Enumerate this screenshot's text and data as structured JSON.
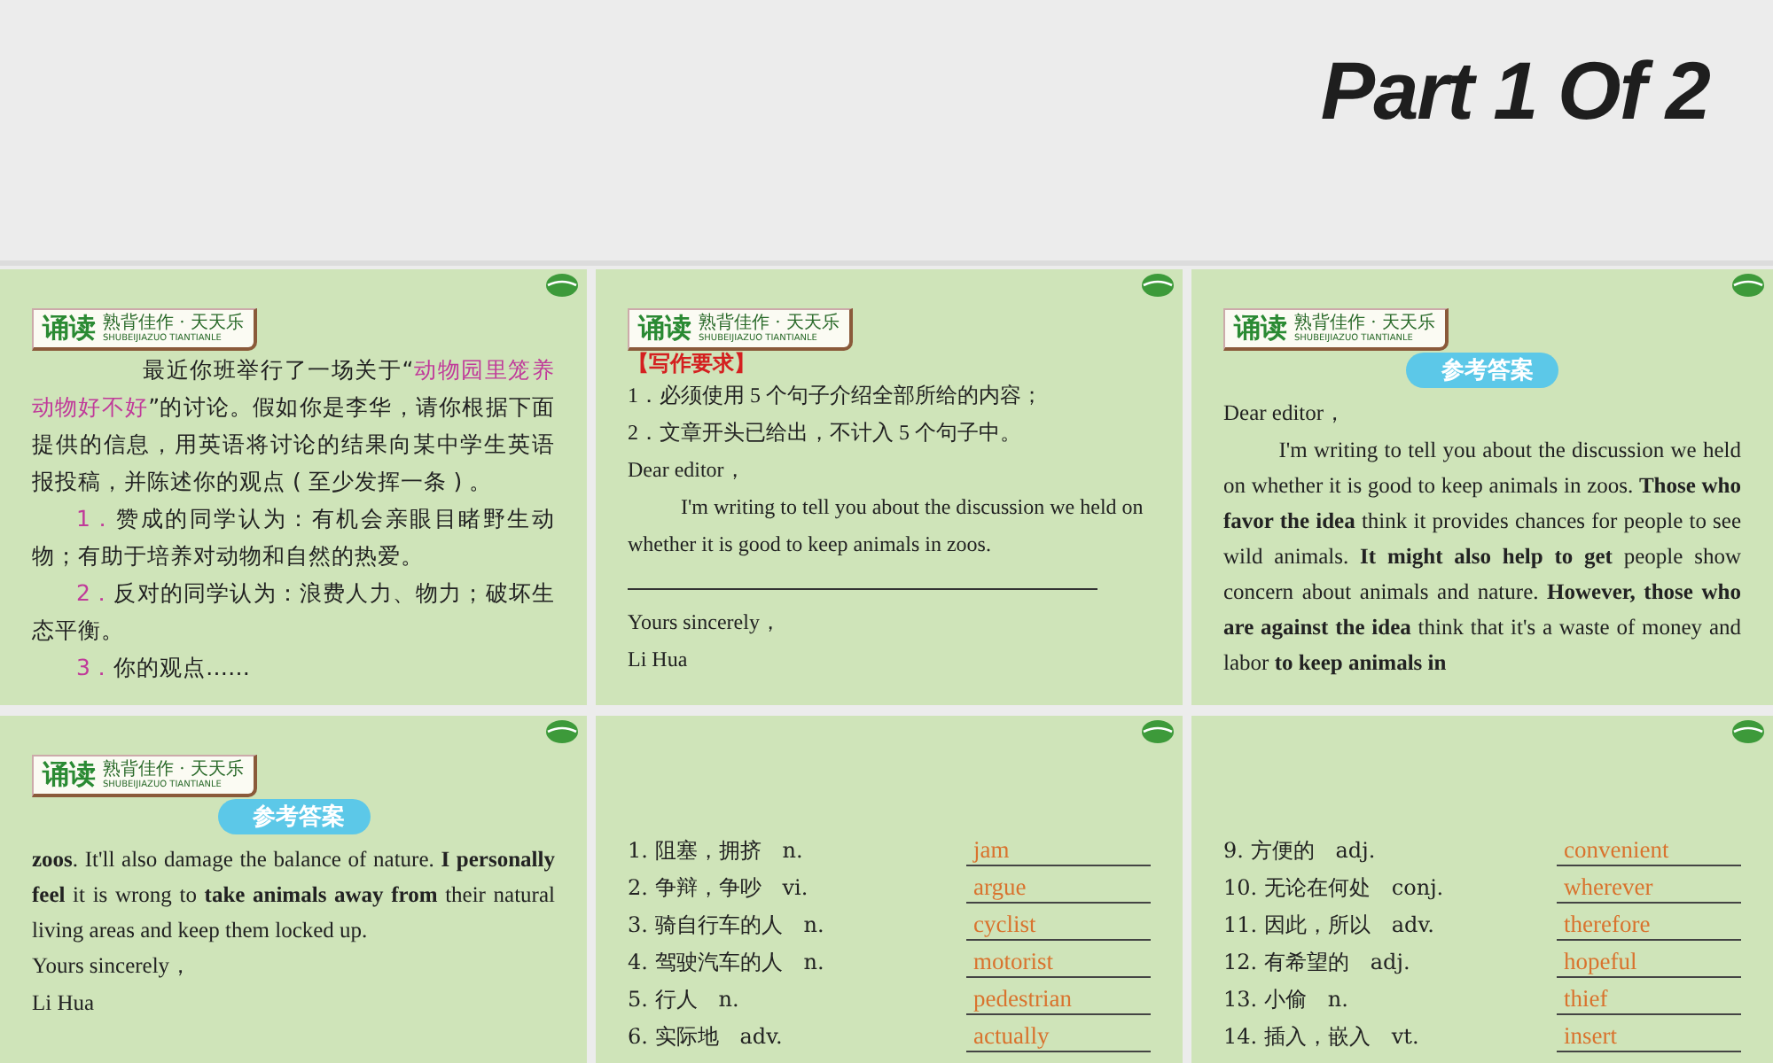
{
  "title": "Part 1 Of 2",
  "slides": [
    {
      "kind": "prompt",
      "badge": {
        "mark": "诵读",
        "title": "熟背佳作 · 天天乐",
        "subtitle": "SHUBEIJIAZUO TIANTIANLE"
      },
      "paragraphs": [
        {
          "parts": [
            {
              "text": "最近你班举行了一场关于“",
              "highlight": false
            },
            {
              "text": "动物园里笼养动物好不好",
              "highlight": true
            },
            {
              "text": "”的讨论。假如你是李华，请你根据下面提供的信息，用英语将讨论的结果向某中学生英语报投稿，并陈述你的观点 ( 至少发挥一条 ) 。",
              "highlight": false
            }
          ]
        },
        {
          "parts": [
            {
              "text": "1．",
              "highlight": true
            },
            {
              "text": "赞成的同学认为：有机会亲眼目睹野生动物；有助于培养对动物和自然的热爱。",
              "highlight": false
            }
          ]
        },
        {
          "parts": [
            {
              "text": "2．",
              "highlight": true
            },
            {
              "text": "反对的同学认为：浪费人力、物力；破坏生态平衡。",
              "highlight": false
            }
          ]
        },
        {
          "parts": [
            {
              "text": "3．",
              "highlight": true
            },
            {
              "text": "你的观点……",
              "highlight": false
            }
          ]
        }
      ]
    },
    {
      "kind": "requirements",
      "badge": {
        "mark": "诵读",
        "title": "熟背佳作 · 天天乐",
        "subtitle": "SHUBEIJIAZUO TIANTIANLE"
      },
      "heading": "【写作要求】",
      "lines": [
        {
          "kind": "line",
          "text": "1．必须使用 5 个句子介绍全部所给的内容；"
        },
        {
          "kind": "line",
          "text": "2．文章开头已给出，不计入 5 个句子中。"
        },
        {
          "kind": "line",
          "text": "Dear editor，"
        },
        {
          "kind": "indented",
          "text": "I'm writing to tell you about the discussion we held on whether it is good to keep animals in zoos."
        },
        {
          "kind": "blank"
        },
        {
          "kind": "line",
          "text": "Yours sincerely，"
        },
        {
          "kind": "line",
          "text": "Li Hua"
        }
      ]
    },
    {
      "kind": "answer",
      "badge": {
        "mark": "诵读",
        "title": "熟背佳作 · 天天乐",
        "subtitle": "SHUBEIJIAZUO TIANTIANLE"
      },
      "tag": "参考答案",
      "lines": [
        {
          "kind": "line",
          "text": "Dear editor，"
        },
        {
          "kind": "indented",
          "text": "I'm writing to tell you about the discussion we held on whether it is good to keep animals in zoos. **Those who favor the idea** think it provides chances for people to see wild animals. **It might also help to get** people show concern about animals and nature. **However, those who are against the idea** think that it's a waste of money and labor **to keep animals in**"
        }
      ]
    },
    {
      "kind": "answer",
      "badge": {
        "mark": "诵读",
        "title": "熟背佳作 · 天天乐",
        "subtitle": "SHUBEIJIAZUO TIANTIANLE"
      },
      "tag": "参考答案",
      "lines": [
        {
          "kind": "justified",
          "text": "**zoos**. It'll also damage the balance of nature. **I personally feel** it is wrong to **take animals away from** their natural living areas and keep them locked up."
        },
        {
          "kind": "line",
          "text": "Yours sincerely，"
        },
        {
          "kind": "line",
          "text": "Li Hua"
        }
      ]
    },
    {
      "kind": "vocab",
      "rows": [
        {
          "prompt": "1. 阻塞，拥挤　n.",
          "answer": "jam"
        },
        {
          "prompt": "2. 争辩，争吵　vi.",
          "answer": "argue"
        },
        {
          "prompt": "3. 骑自行车的人　n.",
          "answer": "cyclist"
        },
        {
          "prompt": "4. 驾驶汽车的人　n.",
          "answer": "motorist"
        },
        {
          "prompt": "5. 行人　n.",
          "answer": "pedestrian"
        },
        {
          "prompt": "6. 实际地　adv.",
          "answer": "actually"
        }
      ]
    },
    {
      "kind": "vocab",
      "rows": [
        {
          "prompt": "9. 方便的　adj.",
          "answer": "convenient"
        },
        {
          "prompt": "10. 无论在何处　conj.",
          "answer": "wherever"
        },
        {
          "prompt": "11. 因此，所以　adv.",
          "answer": "therefore"
        },
        {
          "prompt": "12. 有希望的　adj.",
          "answer": "hopeful"
        },
        {
          "prompt": "13. 小偷　n.",
          "answer": "thief"
        },
        {
          "prompt": "14. 插入，嵌入　vt.",
          "answer": "insert"
        }
      ]
    }
  ]
}
